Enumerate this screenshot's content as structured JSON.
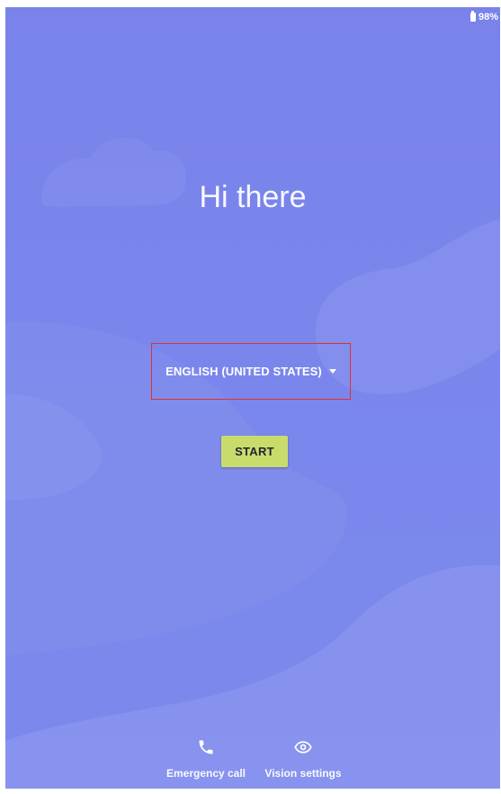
{
  "status_bar": {
    "battery_percent": "98%",
    "battery_icon": "battery-icon"
  },
  "welcome": {
    "title": "Hi there"
  },
  "language": {
    "selected": "ENGLISH (UNITED STATES)",
    "arrow_icon": "dropdown-arrow-icon"
  },
  "actions": {
    "start_label": "START"
  },
  "bottom": {
    "emergency_label": "Emergency call",
    "emergency_icon": "phone-icon",
    "vision_label": "Vision settings",
    "vision_icon": "eye-icon"
  },
  "colors": {
    "background": "#7a86ec",
    "start_button": "#c8dc6c",
    "highlight_border": "#e03131",
    "text": "#ffffff"
  }
}
